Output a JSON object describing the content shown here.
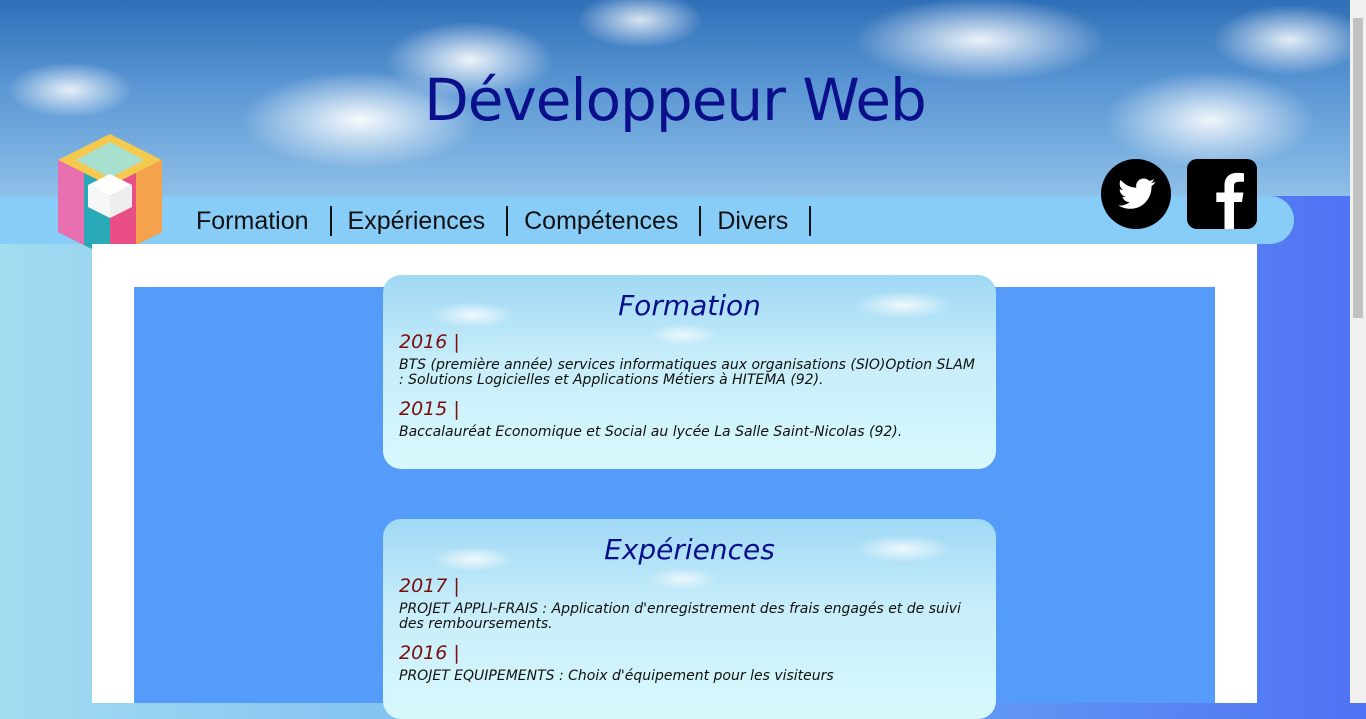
{
  "header": {
    "title": "Développeur Web"
  },
  "nav": {
    "items": [
      "Formation",
      "Expériences",
      "Compétences",
      "Divers"
    ]
  },
  "social": {
    "twitter_icon": "twitter-icon",
    "facebook_icon": "facebook-icon"
  },
  "sections": [
    {
      "title": "Formation",
      "entries": [
        {
          "year": "2016 |",
          "text": "BTS (première année) services informatiques aux organisations (SIO)Option SLAM : Solutions Logicielles et Applications Métiers à HITEMA (92)."
        },
        {
          "year": "2015 |",
          "text": "Baccalauréat Economique et Social au lycée La Salle Saint-Nicolas (92)."
        }
      ]
    },
    {
      "title": "Expériences",
      "entries": [
        {
          "year": "2017 |",
          "text": "PROJET APPLI-FRAIS : Application d'enregistrement des frais engagés et de suivi des remboursements."
        },
        {
          "year": "2016 |",
          "text": "PROJET EQUIPEMENTS : Choix d'équipement pour les visiteurs"
        }
      ]
    }
  ],
  "colors": {
    "title": "#0b0f8a",
    "year": "#7a0d0d",
    "navbar": "#87cdf8",
    "inner_panel": "#559bf9"
  }
}
